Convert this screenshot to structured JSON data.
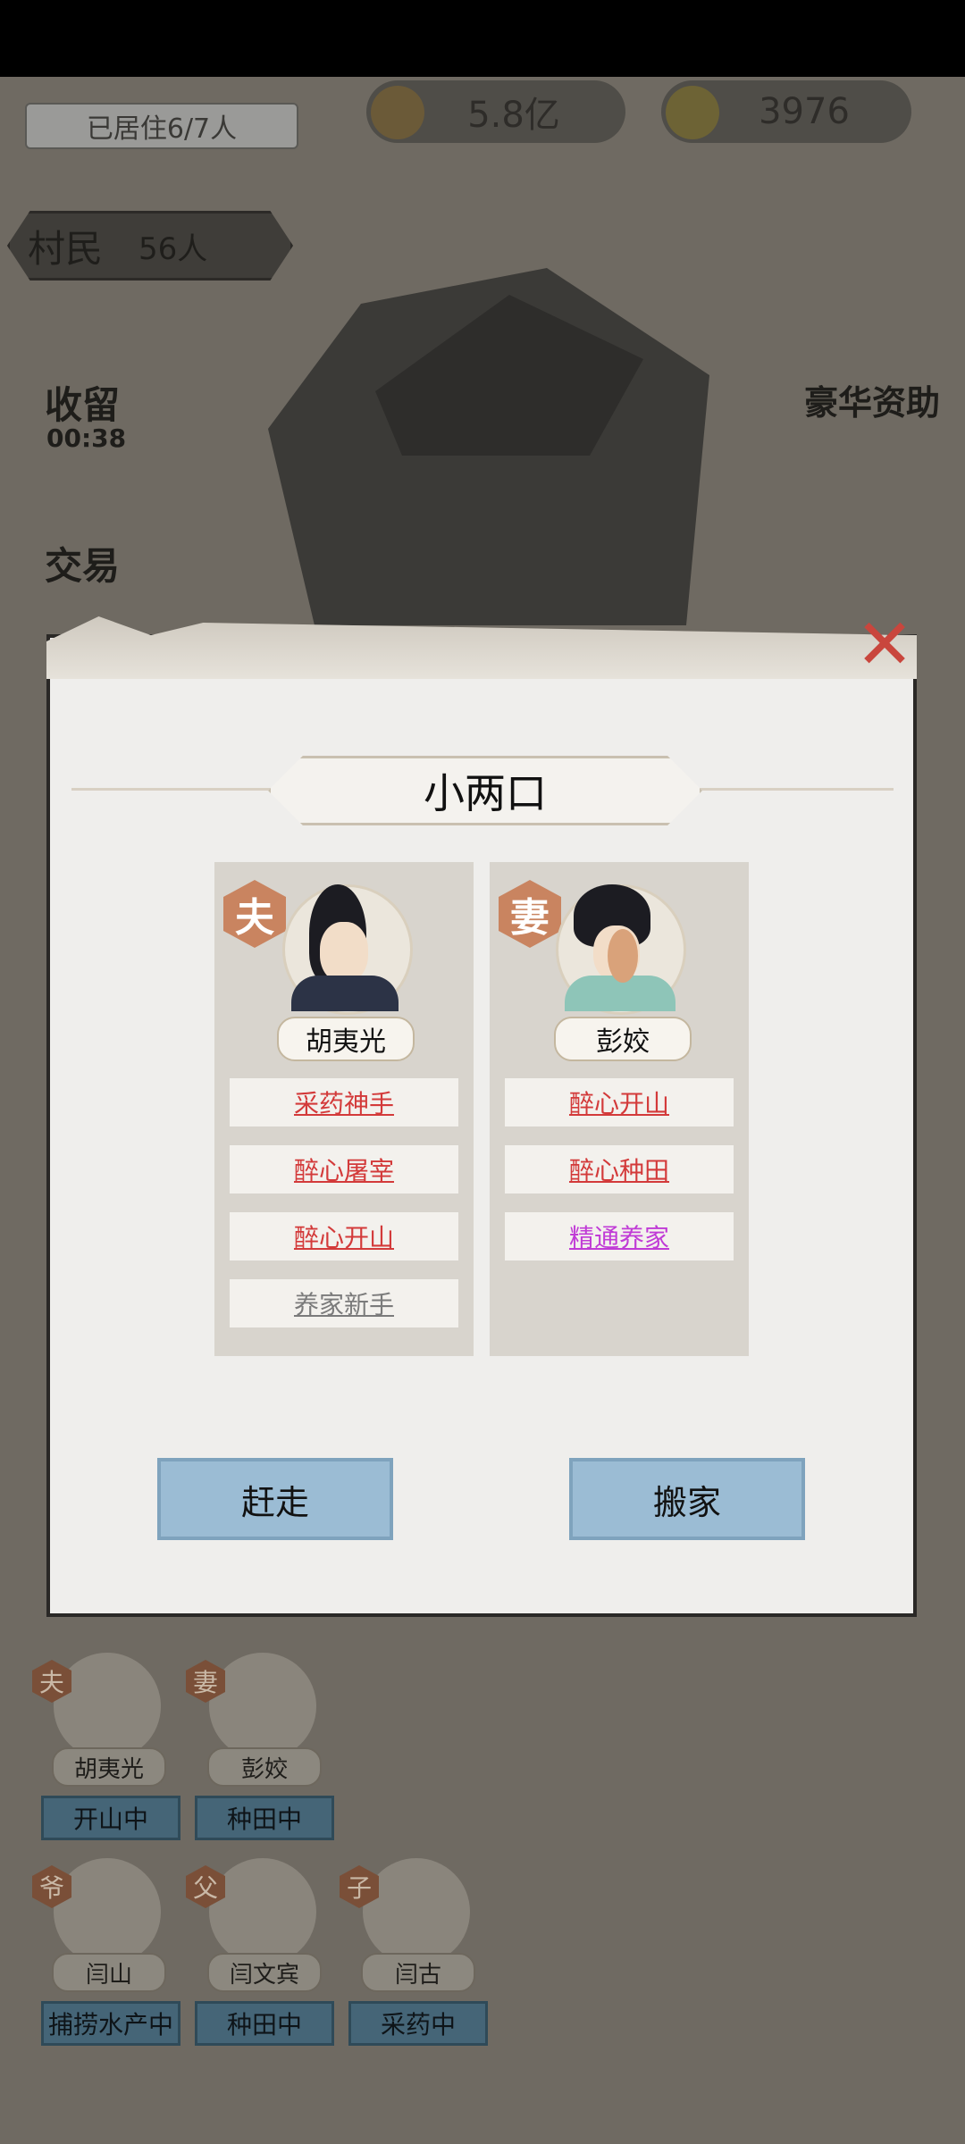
{
  "hud": {
    "residents": "已居住6/7人",
    "money": "5.8亿",
    "gold": "3976",
    "villagers_label": "村民",
    "villagers_count": "56人",
    "shelter_label": "收留",
    "shelter_timer": "00:38",
    "trade_label": "交易",
    "sponsor_label": "豪华资助"
  },
  "dialog": {
    "title": "小两口",
    "husband": {
      "role": "夫",
      "name": "胡夷光",
      "traits": [
        {
          "label": "采药神手",
          "color": "#d33a3a"
        },
        {
          "label": "醉心屠宰",
          "color": "#d33a3a"
        },
        {
          "label": "醉心开山",
          "color": "#d33a3a"
        },
        {
          "label": "养家新手",
          "color": "#7b7b7b"
        }
      ]
    },
    "wife": {
      "role": "妻",
      "name": "彭姣",
      "traits": [
        {
          "label": "醉心开山",
          "color": "#d33a3a"
        },
        {
          "label": "醉心种田",
          "color": "#d33a3a"
        },
        {
          "label": "精通养家",
          "color": "#c03bd6"
        }
      ]
    },
    "evict_button": "赶走",
    "move_button": "搬家"
  },
  "family_list": [
    {
      "role": "夫",
      "name": "胡夷光",
      "status": "开山中"
    },
    {
      "role": "妻",
      "name": "彭姣",
      "status": "种田中"
    },
    {
      "role": "爷",
      "name": "闫山",
      "status": "捕捞水产中"
    },
    {
      "role": "父",
      "name": "闫文宾",
      "status": "种田中"
    },
    {
      "role": "子",
      "name": "闫古",
      "status": "采药中"
    }
  ]
}
